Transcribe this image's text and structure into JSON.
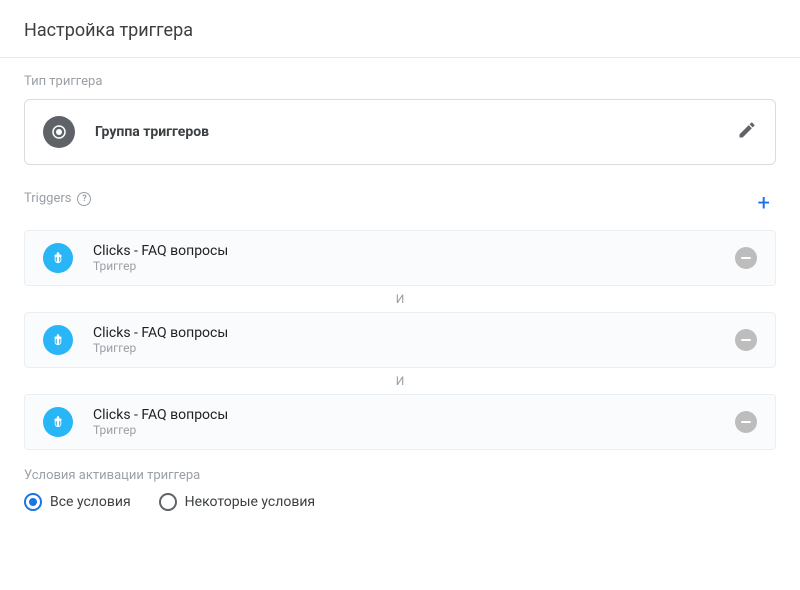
{
  "header": {
    "title": "Настройка триггера"
  },
  "type_section": {
    "label": "Тип триггера",
    "value": "Группа триггеров"
  },
  "triggers_section": {
    "label": "Triggers"
  },
  "connector": "И",
  "triggers": [
    {
      "name": "Clicks - FAQ вопросы",
      "sub": "Триггер"
    },
    {
      "name": "Clicks - FAQ вопросы",
      "sub": "Триггер"
    },
    {
      "name": "Clicks - FAQ вопросы",
      "sub": "Триггер"
    }
  ],
  "conditions": {
    "label": "Условия активации триггера",
    "options": [
      "Все условия",
      "Некоторые условия"
    ],
    "selected": 0
  }
}
